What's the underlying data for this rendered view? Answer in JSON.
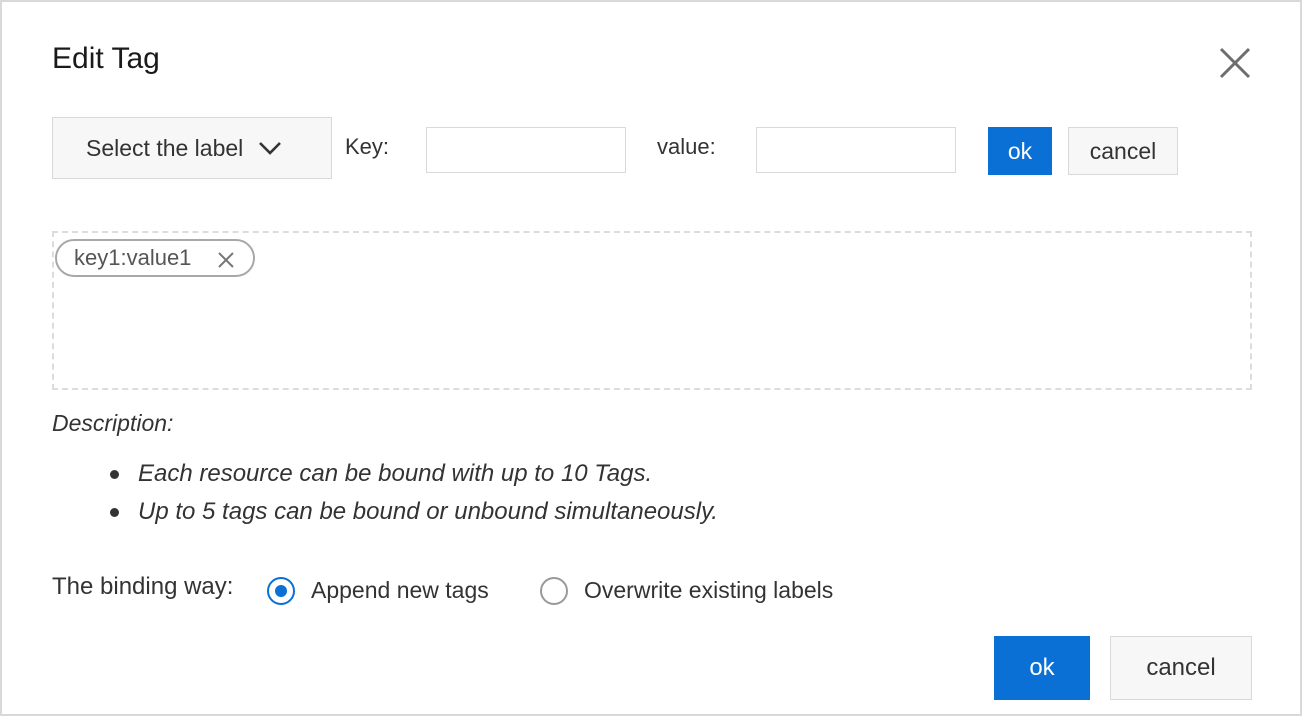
{
  "dialog": {
    "title": "Edit Tag",
    "close_icon": "close-icon"
  },
  "form": {
    "select_label": "Select the label",
    "key_label": "Key:",
    "key_value": "",
    "value_label": "value:",
    "value_value": "",
    "ok_label": "ok",
    "cancel_label": "cancel"
  },
  "tags": [
    {
      "text": "key1:value1",
      "remove_icon": "close-small-icon"
    }
  ],
  "description": {
    "title": "Description:",
    "items": [
      "Each resource can be bound with up to 10 Tags.",
      "Up to 5 tags can be bound or unbound simultaneously."
    ]
  },
  "binding": {
    "label": "The binding way:",
    "options": [
      {
        "label": "Append new tags",
        "selected": true
      },
      {
        "label": "Overwrite existing labels",
        "selected": false
      }
    ]
  },
  "footer": {
    "ok_label": "ok",
    "cancel_label": "cancel"
  },
  "colors": {
    "primary": "#0a70d6",
    "border": "#d9d9d9",
    "text": "#333333"
  }
}
